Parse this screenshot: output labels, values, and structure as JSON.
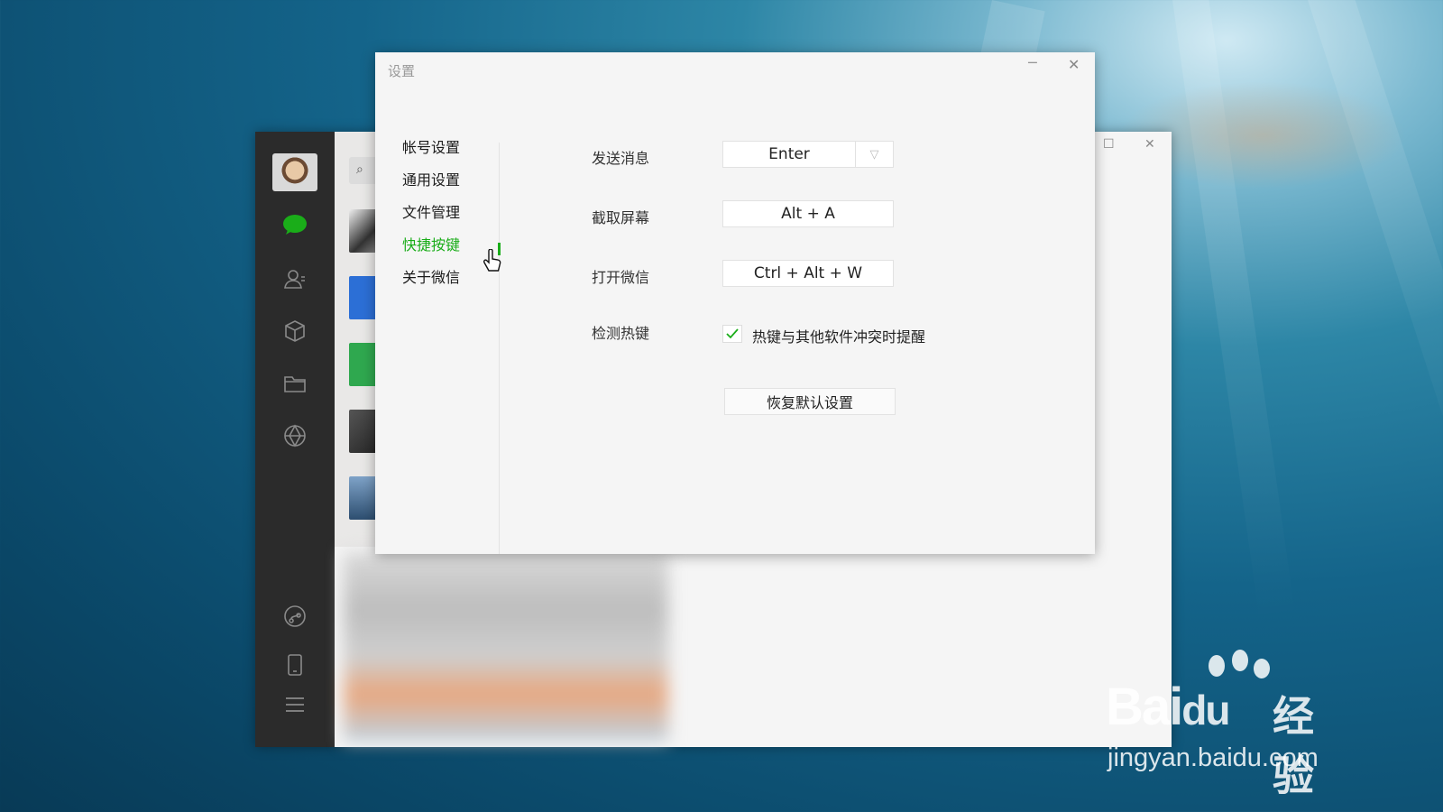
{
  "dialog": {
    "title": "设置",
    "minimize": "─",
    "close": "✕",
    "nav": [
      {
        "label": "帐号设置"
      },
      {
        "label": "通用设置"
      },
      {
        "label": "文件管理"
      },
      {
        "label": "快捷按键",
        "active": true
      },
      {
        "label": "关于微信"
      }
    ],
    "shortcuts": {
      "send": {
        "label": "发送消息",
        "value": "Enter"
      },
      "capture": {
        "label": "截取屏幕",
        "value": "Alt + A"
      },
      "open": {
        "label": "打开微信",
        "value": "Ctrl + Alt + W"
      },
      "detect": {
        "label": "检测热键",
        "checkbox_label": "热键与其他软件冲突时提醒",
        "checked": true
      }
    },
    "restore_button": "恢复默认设置"
  },
  "background_window": {
    "max": "☐",
    "close": "✕"
  },
  "watermark": {
    "brand": "Bai",
    "brand2": "du",
    "sub": "经验",
    "url": "jingyan.baidu.com"
  },
  "colors": {
    "accent": "#1aad19",
    "sidebar": "#2b2b2b"
  }
}
